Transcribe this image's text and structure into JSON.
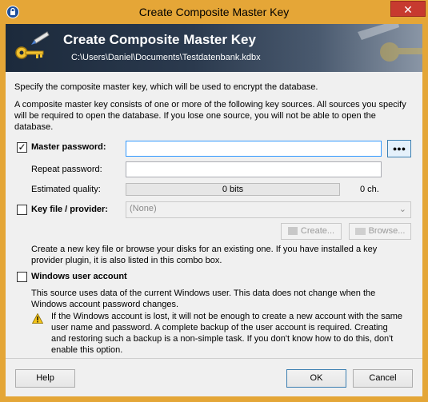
{
  "window": {
    "title": "Create Composite Master Key",
    "close_glyph": "✕"
  },
  "banner": {
    "title": "Create Composite Master Key",
    "subtitle": "C:\\Users\\Daniel\\Documents\\Testdatenbank.kdbx",
    "icon": "keys-icon"
  },
  "intro": {
    "line1": "Specify the composite master key, which will be used to encrypt the database.",
    "line2": "A composite master key consists of one or more of the following key sources. All sources you specify will be required to open the database.  If you lose one source, you will not be able to open the database."
  },
  "master_password": {
    "checked": true,
    "check_glyph": "✓",
    "label": "Master password:",
    "value": "",
    "toggle_label": "●●●",
    "repeat_label": "Repeat password:",
    "repeat_value": "",
    "quality_label": "Estimated quality:",
    "quality_value": "0 bits",
    "quality_fraction": 0,
    "char_count": "0 ch."
  },
  "key_file": {
    "checked": false,
    "label": "Key file / provider:",
    "selected": "(None)",
    "create_label": "Create...",
    "browse_label": "Browse...",
    "hint": "Create a new key file or browse your disks for an existing one. If you have installed a key provider plugin, it is also listed in this combo box."
  },
  "windows_account": {
    "checked": false,
    "label": "Windows user account",
    "hint": "This source uses data of the current Windows user. This data does not change when the Windows account password changes.",
    "warning": "If the Windows account is lost, it will not be enough to create a new account with the same user name and password. A complete backup of the user account is required. Creating and restoring such a backup is a non-simple task. If you don't know how to do this, don't enable this option.",
    "warning_icon": "warning-icon"
  },
  "footer": {
    "help_label": "Help",
    "ok_label": "OK",
    "cancel_label": "Cancel"
  }
}
